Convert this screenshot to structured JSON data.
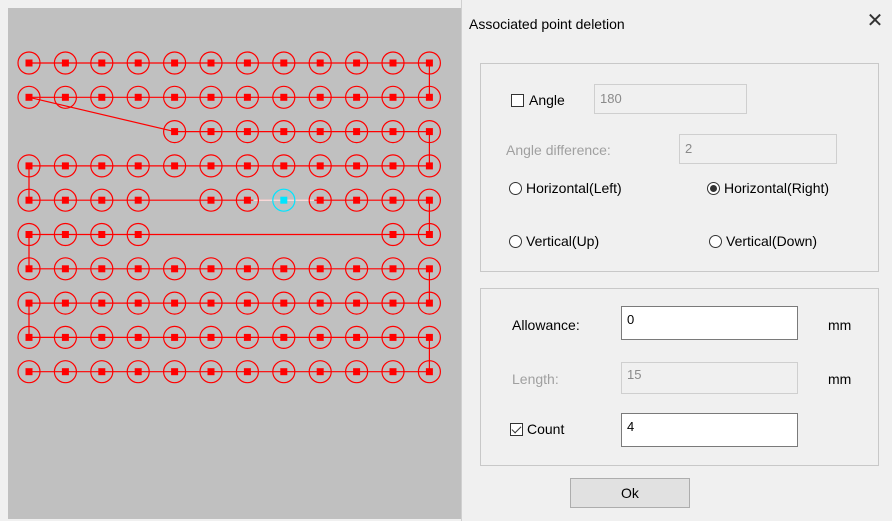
{
  "dialog": {
    "title": "Associated point deletion",
    "close_glyph": "✕",
    "angle_checkbox": {
      "label": "Angle",
      "checked": false
    },
    "angle_value": "180",
    "angle_difference_label": "Angle difference:",
    "angle_difference_value": "2",
    "radios": [
      {
        "label": "Horizontal(Left)",
        "checked": false
      },
      {
        "label": "Horizontal(Right)",
        "checked": true
      },
      {
        "label": "Vertical(Up)",
        "checked": false
      },
      {
        "label": "Vertical(Down)",
        "checked": false
      }
    ],
    "allowance_label": "Allowance:",
    "allowance_value": "0",
    "allowance_unit": "mm",
    "length_label": "Length:",
    "length_value": "15",
    "length_unit": "mm",
    "count_checkbox": {
      "label": "Count",
      "checked": true
    },
    "count_value": "4",
    "ok_label": "Ok"
  },
  "canvas": {
    "background": "#c0c0c0",
    "point_color": "#ff0000",
    "selected_color": "#00e5ff",
    "columns": 12,
    "rows": 10,
    "missing_points": [
      [
        2,
        0
      ],
      [
        2,
        1
      ],
      [
        2,
        2
      ],
      [
        2,
        3
      ],
      [
        4,
        4
      ],
      [
        5,
        4
      ],
      [
        5,
        5
      ],
      [
        5,
        6
      ],
      [
        5,
        7
      ],
      [
        5,
        8
      ],
      [
        5,
        9
      ]
    ],
    "selected_point": [
      4,
      7
    ]
  }
}
